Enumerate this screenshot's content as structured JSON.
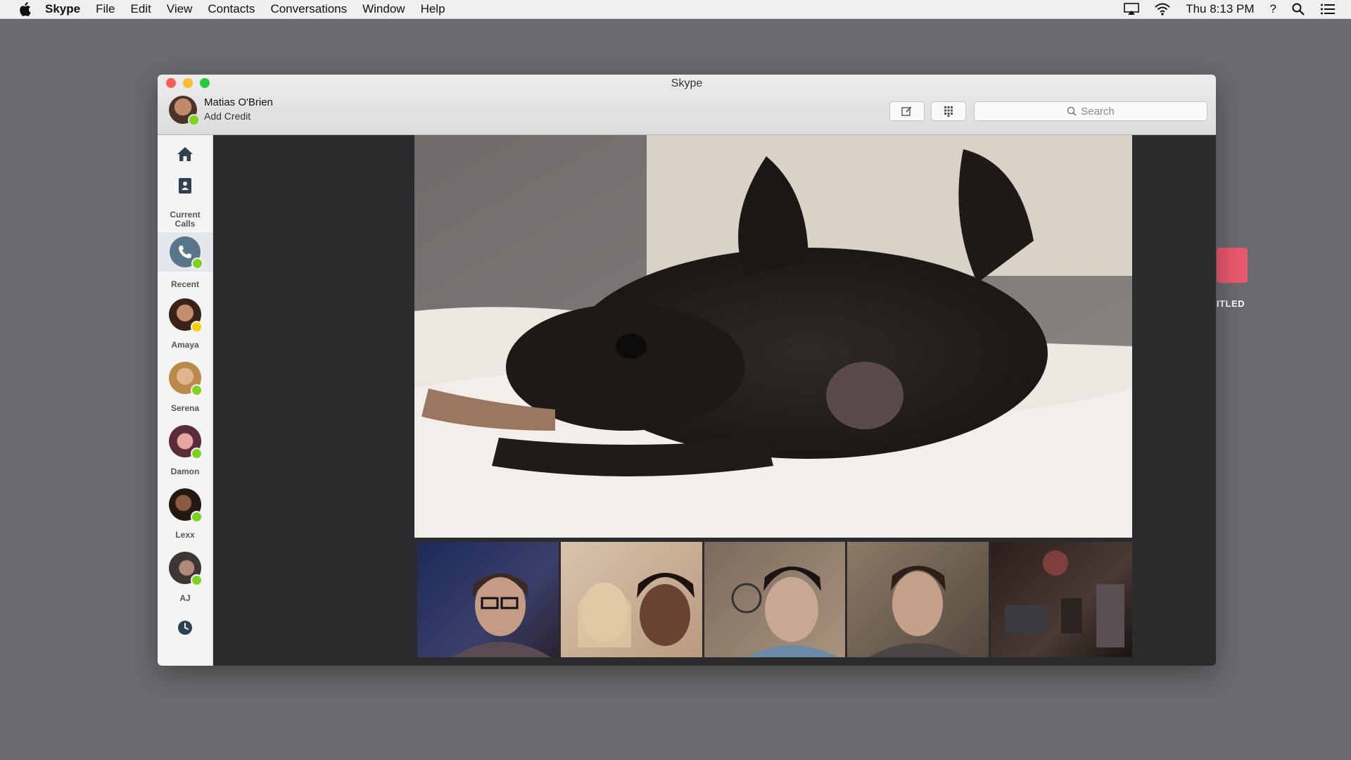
{
  "menubar": {
    "items": [
      "Skype",
      "File",
      "Edit",
      "View",
      "Contacts",
      "Conversations",
      "Window",
      "Help"
    ],
    "clock": "Thu 8:13 PM",
    "help_symbol": "?"
  },
  "desktop": {
    "widget_label": "ITLED"
  },
  "window": {
    "title": "Skype",
    "user": {
      "name": "Matias O'Brien",
      "credit_link": "Add Credit",
      "status": "online"
    },
    "search_placeholder": "Search",
    "sidebar": {
      "current_calls_label": "Current\nCalls",
      "recent_label": "Recent",
      "contacts": [
        {
          "name": "Amaya",
          "status": "away"
        },
        {
          "name": "Serena",
          "status": "online"
        },
        {
          "name": "Damon",
          "status": "online"
        },
        {
          "name": "Lexx",
          "status": "online"
        },
        {
          "name": "AJ",
          "status": "online"
        }
      ]
    },
    "call": {
      "main_video": "dog-video",
      "participants": [
        "participant-1",
        "participant-2",
        "participant-3",
        "participant-4",
        "participant-5"
      ]
    }
  },
  "colors": {
    "accent": "#59768c",
    "online": "#7ed321",
    "away": "#f8d000"
  }
}
